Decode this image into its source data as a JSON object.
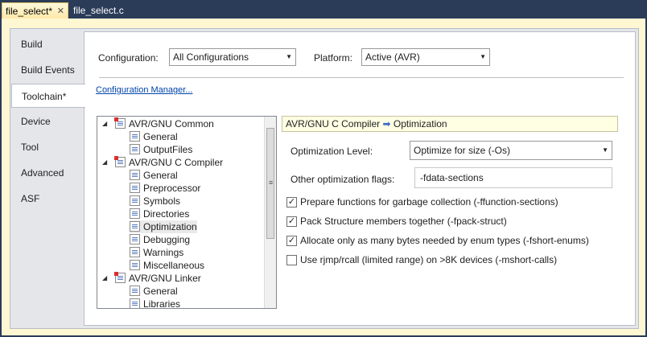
{
  "tabs": {
    "active": "file_select*",
    "inactive": "file_select.c",
    "close_glyph": "✕"
  },
  "sidebar": {
    "items": [
      "Build",
      "Build Events",
      "Toolchain*",
      "Device",
      "Tool",
      "Advanced",
      "ASF"
    ],
    "selected": "Toolchain*"
  },
  "config": {
    "configuration_label": "Configuration:",
    "configuration_value": "All Configurations",
    "platform_label": "Platform:",
    "platform_value": "Active (AVR)",
    "manager_link": "Configuration Manager..."
  },
  "tree": {
    "rows": [
      {
        "label": "AVR/GNU Common",
        "level": 0,
        "expanded": true
      },
      {
        "label": "General",
        "level": 1
      },
      {
        "label": "OutputFiles",
        "level": 1
      },
      {
        "label": "AVR/GNU C Compiler",
        "level": 0,
        "expanded": true
      },
      {
        "label": "General",
        "level": 1
      },
      {
        "label": "Preprocessor",
        "level": 1
      },
      {
        "label": "Symbols",
        "level": 1
      },
      {
        "label": "Directories",
        "level": 1
      },
      {
        "label": "Optimization",
        "level": 1,
        "selected": true
      },
      {
        "label": "Debugging",
        "level": 1
      },
      {
        "label": "Warnings",
        "level": 1
      },
      {
        "label": "Miscellaneous",
        "level": 1
      },
      {
        "label": "AVR/GNU Linker",
        "level": 0,
        "expanded": true
      },
      {
        "label": "General",
        "level": 1
      },
      {
        "label": "Libraries",
        "level": 1
      }
    ]
  },
  "panel": {
    "header_part1": "AVR/GNU C Compiler",
    "header_arrow": "➡",
    "header_part2": "Optimization",
    "opt_level_label": "Optimization Level:",
    "opt_level_value": "Optimize for size (-Os)",
    "other_flags_label": "Other optimization flags:",
    "other_flags_value": "-fdata-sections",
    "checkboxes": [
      {
        "label": "Prepare functions for garbage collection (-ffunction-sections)",
        "checked": true
      },
      {
        "label": "Pack Structure members together (-fpack-struct)",
        "checked": true
      },
      {
        "label": "Allocate only as many bytes needed by enum types (-fshort-enums)",
        "checked": true
      },
      {
        "label": "Use rjmp/rcall (limited range) on >8K devices (-mshort-calls)",
        "checked": false
      }
    ]
  },
  "colors": {
    "window_bg": "#2b3c59",
    "active_tab": "#ffe9a8",
    "link": "#0044aa",
    "header_bg": "#ffffe4"
  }
}
